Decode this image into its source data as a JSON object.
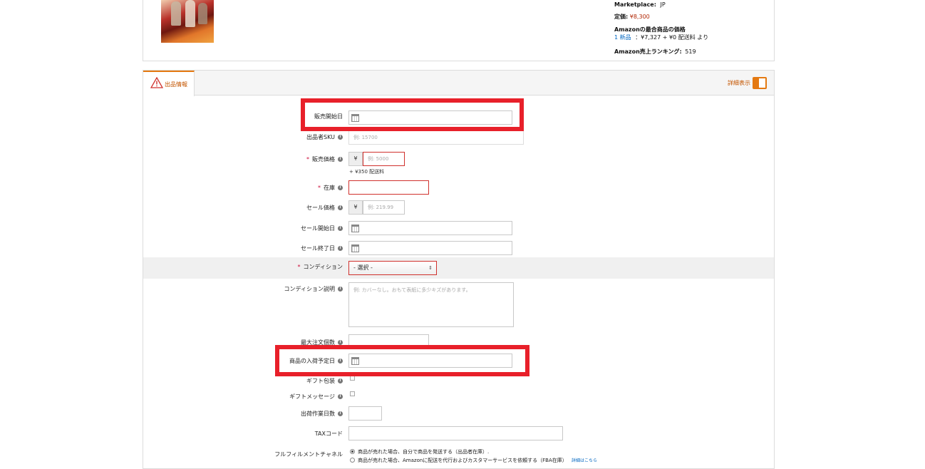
{
  "product": {
    "marketplace_label": "Marketplace:",
    "marketplace_value": "JP",
    "list_price_label": "定価:",
    "list_price_value": "¥8,300",
    "lowest_price_title": "Amazonの最合商品の価格",
    "offer_count": "1 新品",
    "offer_detail": "：¥7,327 + ¥0 配送料 より",
    "rank_label": "Amazon売上ランキング:",
    "rank_value": "519"
  },
  "tabs": {
    "offer_tab_label": "出品情報",
    "detail_toggle_label": "詳細表示"
  },
  "form": {
    "release_date_label": "販売開始日",
    "sku_label": "出品者SKU",
    "sku_placeholder": "例: 15700",
    "price_label": "販売価格",
    "currency_symbol": "¥",
    "price_placeholder": "例: 5000",
    "shipping_note": "+ ¥350 配送料",
    "quantity_label": "在庫",
    "sale_price_label": "セール価格",
    "sale_price_placeholder": "例: 219.99",
    "sale_start_label": "セール開始日",
    "sale_end_label": "セール終了日",
    "condition_label": "コンディション",
    "condition_selected": "- 選択 -",
    "condition_note_label": "コンディション説明",
    "condition_note_placeholder": "例: カバーなし。おもて表紙に多少キズがあります。",
    "max_order_label": "最大注文個数",
    "restock_date_label": "商品の入荷予定日",
    "gift_wrap_label": "ギフト包装",
    "gift_message_label": "ギフトメッセージ",
    "handling_time_label": "出荷作業日数",
    "tax_code_label": "TAXコード",
    "fulfillment_label": "フルフィルメントチャネル",
    "fulfillment_option_merchant": "商品が売れた場合、自分で商品を発送する（出品者在庫）.",
    "fulfillment_option_fba": "商品が売れた場合、Amazonに配送を代行およびカスタマーサービスを依頼する（FBA在庫）",
    "fulfillment_more_link": "詳細はこちら",
    "required_mark": "*",
    "info_mark": "i"
  },
  "colors": {
    "highlight": "#e8202a",
    "accent": "#e47911",
    "error_border": "#d0312d"
  }
}
